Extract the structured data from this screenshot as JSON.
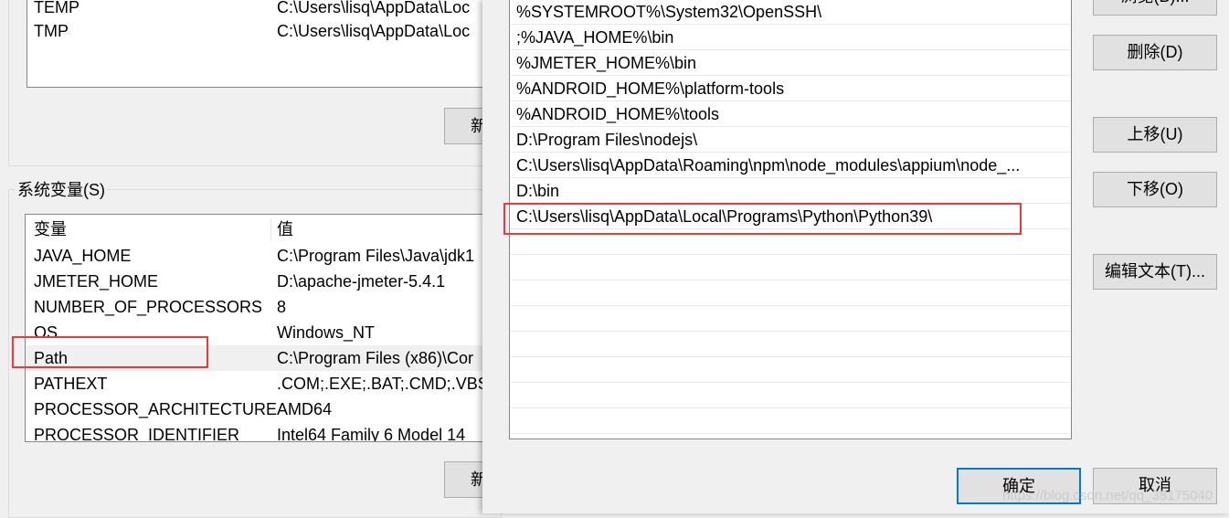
{
  "user_vars": {
    "rows": [
      {
        "name": "TEMP",
        "value": "C:\\Users\\lisq\\AppData\\Loc"
      },
      {
        "name": "TMP",
        "value": "C:\\Users\\lisq\\AppData\\Loc"
      }
    ],
    "new_button": "新"
  },
  "system_vars": {
    "group_label": "系统变量(S)",
    "col_name": "变量",
    "col_value": "值",
    "rows": [
      {
        "name": "JAVA_HOME",
        "value": "C:\\Program Files\\Java\\jdk1"
      },
      {
        "name": "JMETER_HOME",
        "value": "D:\\apache-jmeter-5.4.1"
      },
      {
        "name": "NUMBER_OF_PROCESSORS",
        "value": "8"
      },
      {
        "name": "OS",
        "value": "Windows_NT"
      },
      {
        "name": "Path",
        "value": "C:\\Program Files (x86)\\Cor"
      },
      {
        "name": "PATHEXT",
        "value": ".COM;.EXE;.BAT;.CMD;.VBS;"
      },
      {
        "name": "PROCESSOR_ARCHITECTURE",
        "value": "AMD64"
      },
      {
        "name": "PROCESSOR_IDENTIFIER",
        "value": "Intel64 Family 6 Model 14"
      }
    ],
    "new_button": "新"
  },
  "edit_path": {
    "entries": [
      "%SYSTEMROOT%\\System32\\OpenSSH\\",
      ";%JAVA_HOME%\\bin",
      "%JMETER_HOME%\\bin",
      "%ANDROID_HOME%\\platform-tools",
      "%ANDROID_HOME%\\tools",
      "D:\\Program Files\\nodejs\\",
      "C:\\Users\\lisq\\AppData\\Roaming\\npm\\node_modules\\appium\\node_...",
      "D:\\bin",
      "C:\\Users\\lisq\\AppData\\Local\\Programs\\Python\\Python39\\"
    ],
    "buttons": {
      "browse": "浏览(B)...",
      "delete": "删除(D)",
      "move_up": "上移(U)",
      "move_down": "下移(O)",
      "edit_text": "编辑文本(T)...",
      "ok": "确定",
      "cancel": "取消"
    }
  },
  "watermark": "https://blog.csdn.net/qq_38175040",
  "colors": {
    "highlight_box": "#f0383c",
    "default_button_border": "#0078d7"
  }
}
